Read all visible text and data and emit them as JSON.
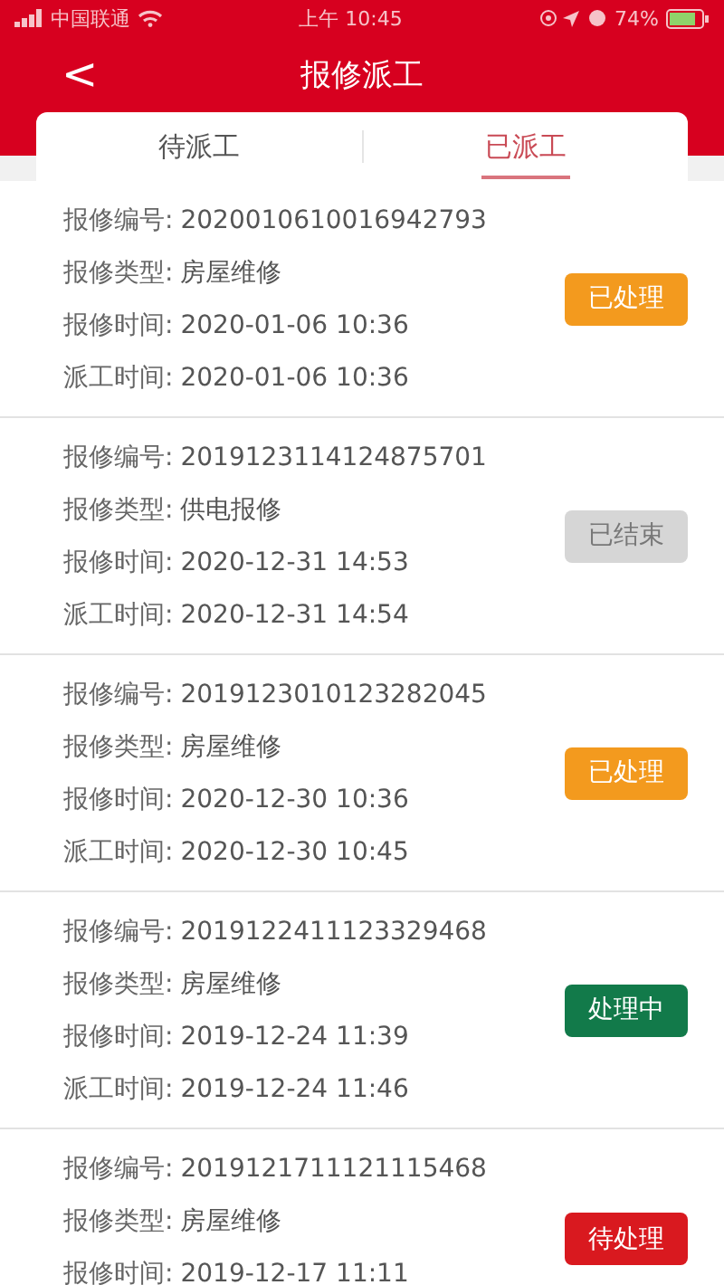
{
  "status_bar": {
    "carrier": "中国联通",
    "time": "上午 10:45",
    "battery": "74%"
  },
  "header": {
    "back": "<",
    "title": "报修派工"
  },
  "tabs": [
    {
      "label": "待派工",
      "selected": false
    },
    {
      "label": "已派工",
      "selected": true
    }
  ],
  "records": [
    {
      "fields": [
        {
          "label": "报修编号:",
          "value": "2020010610016942793"
        },
        {
          "label": "报修类型:",
          "value": "房屋维修"
        },
        {
          "label": "报修时间:",
          "value": "2020-01-06 10:36"
        },
        {
          "label": "派工时间:",
          "value": "2020-01-06 10:36"
        }
      ],
      "status": "已处理",
      "color": "#f39a1e"
    },
    {
      "fields": [
        {
          "label": "报修编号:",
          "value": "2019123114124875701"
        },
        {
          "label": "报修类型:",
          "value": "供电报修"
        },
        {
          "label": "报修时间:",
          "value": "2020-12-31 14:53"
        },
        {
          "label": "派工时间:",
          "value": "2020-12-31 14:54"
        }
      ],
      "status": "已结束",
      "color": "#d6d6d6"
    },
    {
      "fields": [
        {
          "label": "报修编号:",
          "value": "2019123010123282045"
        },
        {
          "label": "报修类型:",
          "value": "房屋维修"
        },
        {
          "label": "报修时间:",
          "value": "2020-12-30 10:36"
        },
        {
          "label": "派工时间:",
          "value": "2020-12-30 10:45"
        }
      ],
      "status": "已处理",
      "color": "#f39a1e"
    },
    {
      "fields": [
        {
          "label": "报修编号:",
          "value": "2019122411123329468"
        },
        {
          "label": "报修类型:",
          "value": "房屋维修"
        },
        {
          "label": "报修时间:",
          "value": "2019-12-24 11:39"
        },
        {
          "label": "派工时间:",
          "value": "2019-12-24 11:46"
        }
      ],
      "status": "处理中",
      "color": "#127a4a"
    },
    {
      "fields": [
        {
          "label": "报修编号:",
          "value": "2019121711121115468"
        },
        {
          "label": "报修类型:",
          "value": "房屋维修"
        },
        {
          "label": "报修时间:",
          "value": "2019-12-17 11:11"
        }
      ],
      "status": "待处理",
      "color": "#d9191f"
    }
  ]
}
